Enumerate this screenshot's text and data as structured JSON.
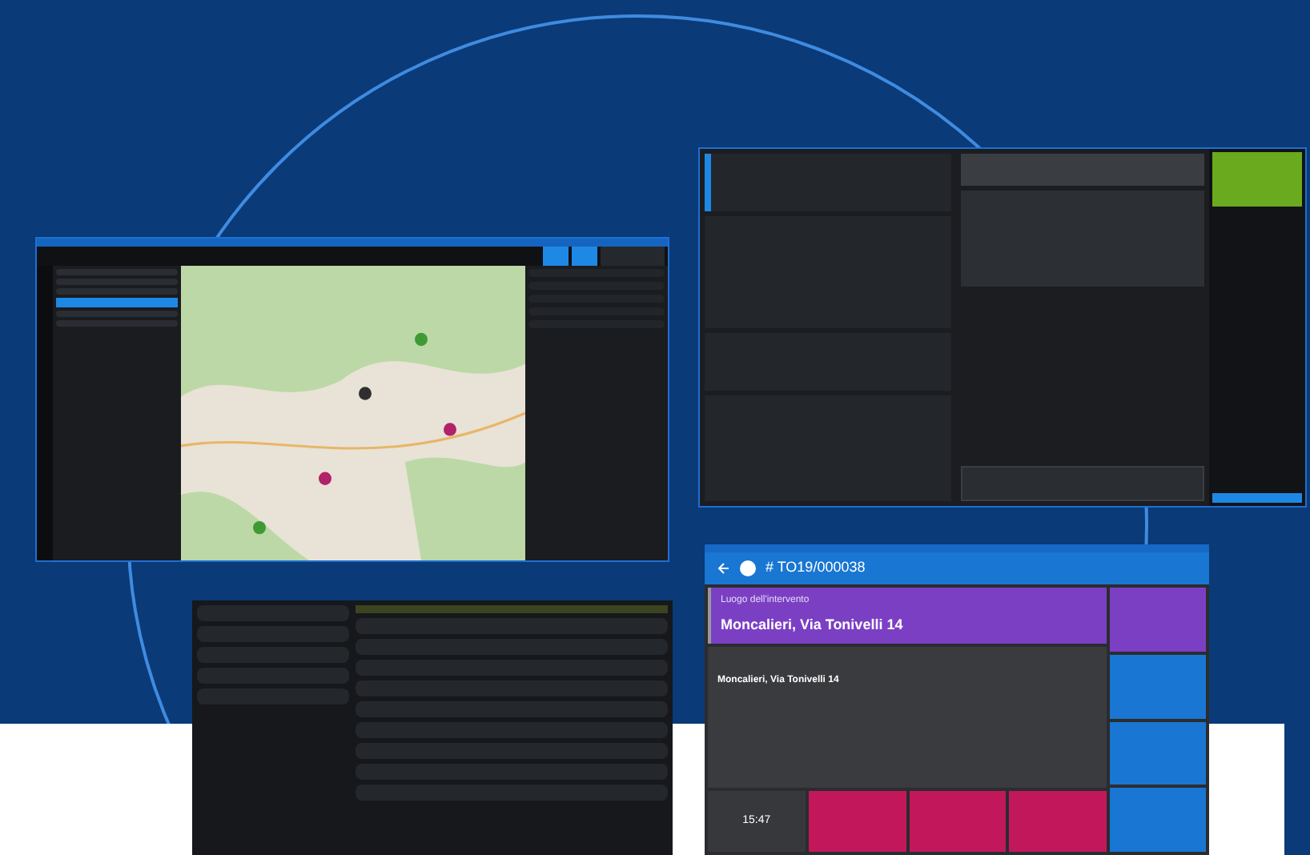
{
  "screens": [
    {
      "kind": "map",
      "markers": [
        {
          "color": "#3f9a34"
        },
        {
          "color": "#b0226a"
        },
        {
          "color": "#b0226a"
        },
        {
          "color": "#3f9a34"
        },
        {
          "color": "#2f2f2f"
        }
      ]
    },
    {
      "kind": "form"
    },
    {
      "kind": "list"
    },
    {
      "kind": "tablet",
      "ticket": "# TO19/000038",
      "place_label": "Luogo dell'intervento",
      "address": "Moncalieri, Via Tonivelli 14",
      "detail_address": "Moncalieri, Via Tonivelli 14",
      "time": "15:47"
    }
  ]
}
